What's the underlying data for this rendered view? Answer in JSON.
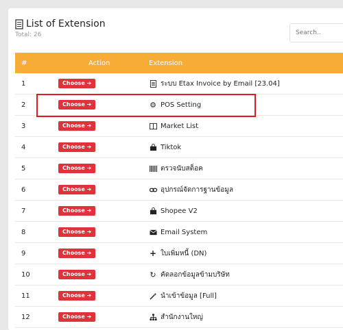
{
  "header": {
    "title": "List of Extension",
    "total": "Total: 26",
    "search_placeholder": "Search.."
  },
  "table": {
    "columns": [
      "#",
      "Action",
      "Extension"
    ],
    "choose_label": "Choose ➔",
    "rows": [
      {
        "num": "1",
        "name": "ระบบ Etax Invoice by Email [23.04]",
        "icon": "document-icon"
      },
      {
        "num": "2",
        "name": "POS Setting",
        "icon": "gears-icon"
      },
      {
        "num": "3",
        "name": "Market List",
        "icon": "columns-icon"
      },
      {
        "num": "4",
        "name": "Tiktok",
        "icon": "shopping-bag-icon"
      },
      {
        "num": "5",
        "name": "ตรวจนับสต็อค",
        "icon": "barcode-icon"
      },
      {
        "num": "6",
        "name": "อุปกรณ์จัดการฐานข้อมูล",
        "icon": "link-icon"
      },
      {
        "num": "7",
        "name": "Shopee V2",
        "icon": "shopping-bag-icon"
      },
      {
        "num": "8",
        "name": "Email System",
        "icon": "envelope-icon"
      },
      {
        "num": "9",
        "name": "ใบเพิ่มหนี้ (DN)",
        "icon": "plus-icon"
      },
      {
        "num": "10",
        "name": "คัดลอกข้อมูลข้ามบริษัท",
        "icon": "refresh-icon"
      },
      {
        "num": "11",
        "name": "นำเข้าข้อมูล [Full]",
        "icon": "magic-wand-icon"
      },
      {
        "num": "12",
        "name": "สำนักงานใหญ่",
        "icon": "sitemap-icon"
      }
    ]
  },
  "highlight_color": "#e01b1b",
  "header_color": "#f7ad35",
  "button_color": "#e0323b"
}
